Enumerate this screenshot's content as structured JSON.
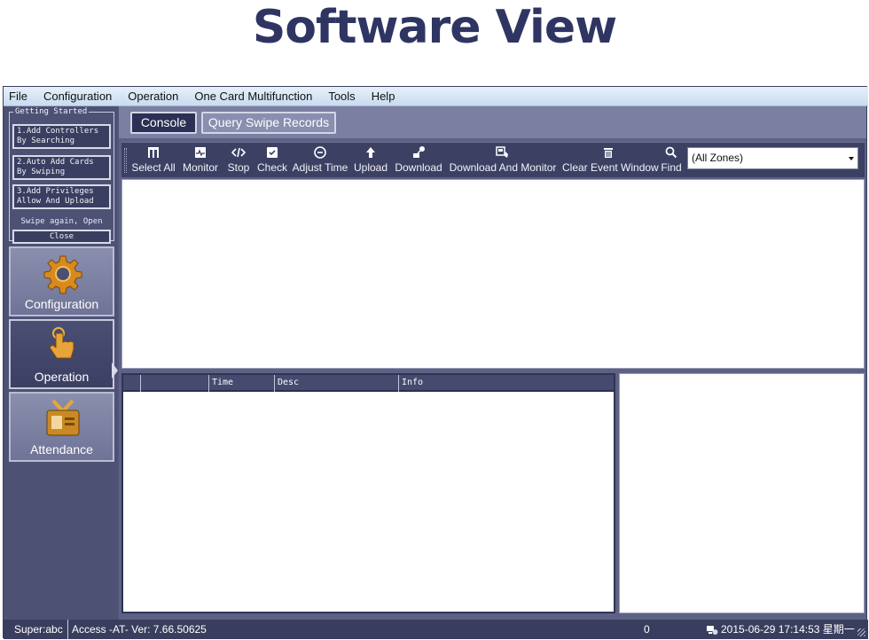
{
  "page_title": "Software View",
  "menu": [
    "File",
    "Configuration",
    "Operation",
    "One Card Multifunction",
    "Tools",
    "Help"
  ],
  "getting_started": {
    "legend": "Getting Started",
    "steps": [
      {
        "line1": "1.Add Controllers",
        "line2": "By Searching"
      },
      {
        "line1": "2.Auto Add Cards",
        "line2": "By Swiping"
      },
      {
        "line1": "3.Add Privileges",
        "line2": "Allow And Upload"
      }
    ],
    "hint": "Swipe again, Open",
    "close": "Close"
  },
  "nav": [
    {
      "label": "Configuration",
      "icon": "gear-icon"
    },
    {
      "label": "Operation",
      "icon": "hand-pointer-icon"
    },
    {
      "label": "Attendance",
      "icon": "id-badge-icon"
    }
  ],
  "tabs": [
    "Console",
    "Query Swipe Records"
  ],
  "toolbar": [
    {
      "label": "Select All",
      "icon": "select-all-icon"
    },
    {
      "label": "Monitor",
      "icon": "monitor-icon"
    },
    {
      "label": "Stop",
      "icon": "stop-icon"
    },
    {
      "label": "Check",
      "icon": "check-icon"
    },
    {
      "label": "Adjust Time",
      "icon": "clock-icon"
    },
    {
      "label": "Upload",
      "icon": "upload-arrow-icon"
    },
    {
      "label": "Download",
      "icon": "download-icon"
    },
    {
      "label": "Download And Monitor",
      "icon": "download-monitor-icon"
    },
    {
      "label": "Clear Event Window",
      "icon": "trash-icon"
    },
    {
      "label": "Find",
      "icon": "search-icon"
    }
  ],
  "zone_select": {
    "value": "(All Zones)"
  },
  "event_columns": [
    "",
    "",
    "Time",
    "Desc",
    "Info"
  ],
  "status": {
    "user": "Super:abc",
    "version": "Access -AT- Ver: 7.66.50625",
    "count": "0",
    "datetime": "2015-06-29 17:14:53 星期一"
  },
  "colors": {
    "title": "#2f3563",
    "panel": "#4f5478",
    "toolbar": "#3c4164",
    "active_tab": "#2c3054"
  }
}
